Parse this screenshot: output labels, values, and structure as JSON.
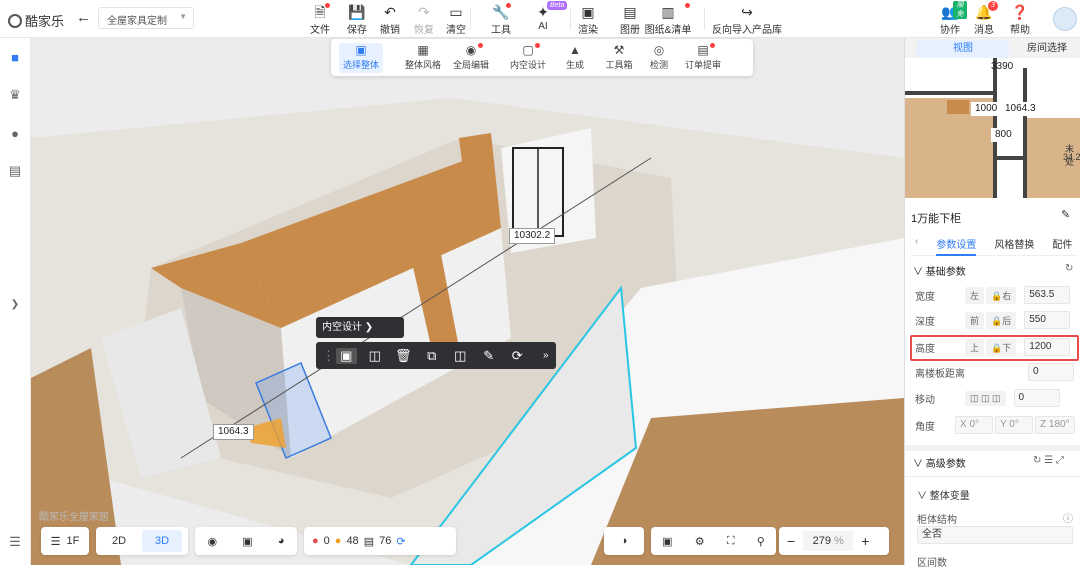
{
  "app": {
    "logo": "酷家乐",
    "project": "全屋家具定制"
  },
  "toolbar": [
    {
      "label": "文件",
      "icon": "file-icon",
      "dot": true
    },
    {
      "label": "保存",
      "icon": "save-icon"
    },
    {
      "label": "撤销",
      "icon": "undo-icon"
    },
    {
      "label": "恢复",
      "icon": "redo-icon",
      "disabled": true
    },
    {
      "label": "清空",
      "icon": "eraser-icon"
    },
    {
      "label": "工具",
      "icon": "wrench-icon",
      "dot": true
    },
    {
      "label": "AI",
      "icon": "ai-icon",
      "beta": "Beta"
    },
    {
      "label": "渲染",
      "icon": "render-icon"
    },
    {
      "label": "图册",
      "icon": "album-icon"
    },
    {
      "label": "图纸&清单",
      "icon": "drawing-icon",
      "dot": true
    },
    {
      "label": "反向导入产品库",
      "icon": "import-icon"
    }
  ],
  "right_tools": [
    {
      "label": "协作",
      "badge": "限免"
    },
    {
      "label": "消息",
      "count": "3"
    },
    {
      "label": "帮助"
    }
  ],
  "subtoolbar": [
    {
      "label": "选择整体",
      "active": true
    },
    {
      "label": "整体风格"
    },
    {
      "label": "全局编辑",
      "dot": true
    },
    {
      "label": "内空设计",
      "dot": true
    },
    {
      "label": "生成"
    },
    {
      "label": "工具箱"
    },
    {
      "label": "检测"
    },
    {
      "label": "订单提审",
      "dot": true
    }
  ],
  "scene": {
    "dim_top": "10302.2",
    "dim_left": "1064.3",
    "inner_design": "内空设计",
    "watermark": "酷家乐全屋家居"
  },
  "bottom": {
    "floor": "1F",
    "mode2d": "2D",
    "mode3d": "3D",
    "err": "0",
    "warn": "48",
    "count": "76",
    "zoom": "279",
    "pct": "%"
  },
  "mini": {
    "tab1": "视图",
    "tab2": "房间选择",
    "d1": "3390",
    "d2": "1000",
    "d3": "1064.3",
    "d4": "800",
    "room": "末处",
    "area": "34.2"
  },
  "panel": {
    "title": "1万能下柜",
    "tabs": [
      "参数设置",
      "风格替换",
      "配件"
    ],
    "section": "基础参数",
    "width": {
      "label": "宽度",
      "a": "左",
      "b": "右",
      "value": "563.5"
    },
    "depth": {
      "label": "深度",
      "a": "前",
      "b": "后",
      "value": "550"
    },
    "height": {
      "label": "高度",
      "a": "上",
      "b": "下",
      "value": "1200"
    },
    "floor": {
      "label": "离楼板距离",
      "value": "0"
    },
    "move": {
      "label": "移动",
      "value": "0"
    },
    "angle": {
      "label": "角度",
      "x": "X 0°",
      "y": "Y 0°",
      "z": "Z 180°"
    },
    "adv": "高级参数",
    "var": "整体变量",
    "struct": "柜体结构",
    "struct_val": "全否",
    "gap": "区间数"
  }
}
